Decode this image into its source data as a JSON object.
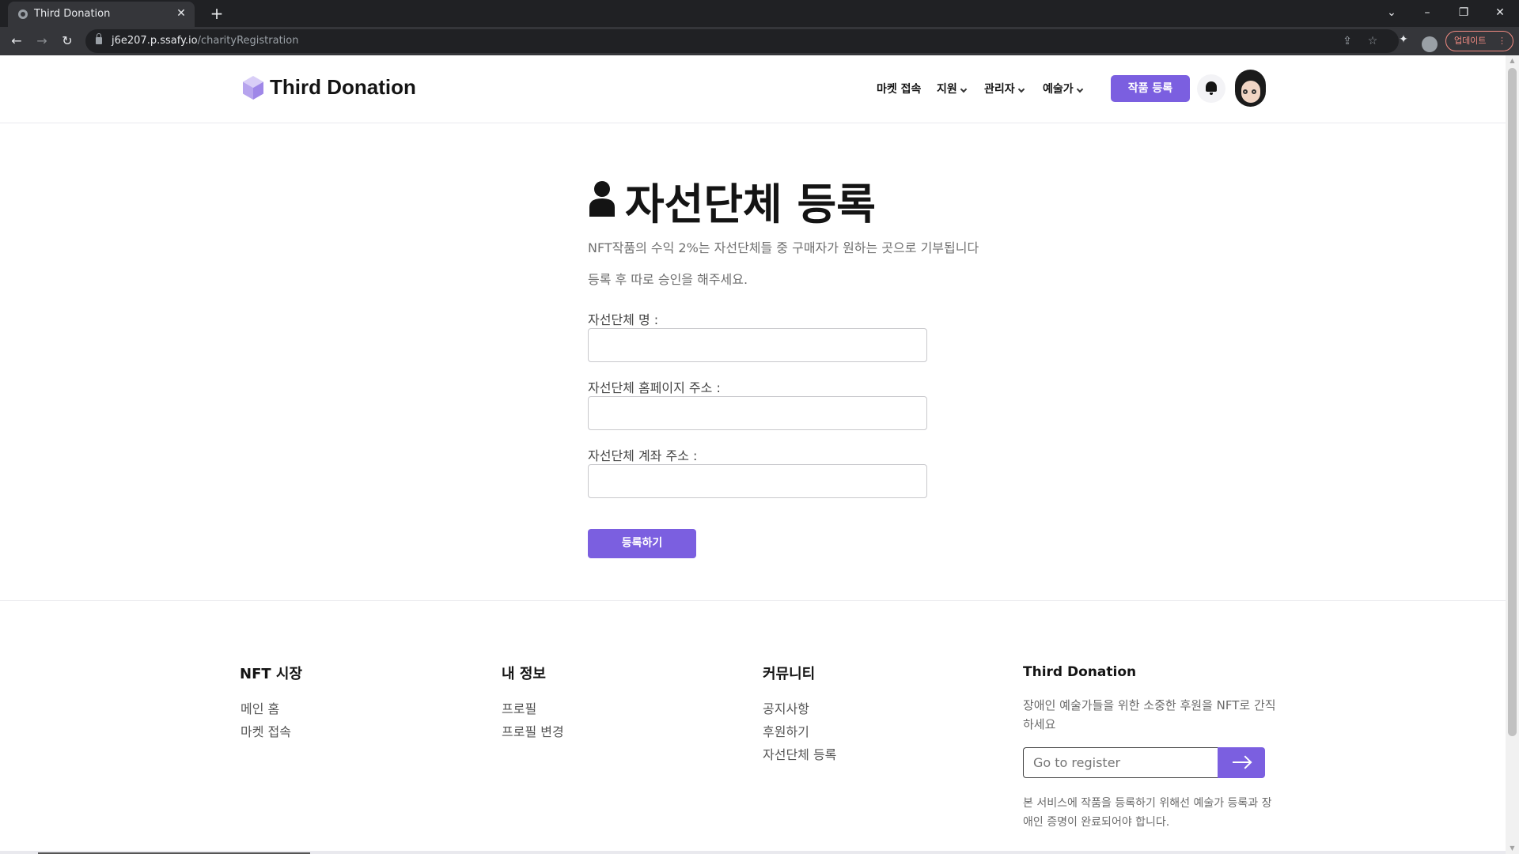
{
  "browser": {
    "tab_title": "Third Donation",
    "tab_close": "✕",
    "new_tab": "+",
    "url_host": "j6e207.p.ssafy.io",
    "url_path": "/charityRegistration",
    "update_label": "업데이트",
    "update_menu": "⋮",
    "window": {
      "tab_search": "⌄",
      "minimize": "–",
      "restore": "❐",
      "close": "✕"
    },
    "nav": {
      "back": "←",
      "forward": "→",
      "reload": "↻"
    },
    "icons": {
      "share": "share-icon",
      "bookmark": "☆",
      "extensions": "puzzle-icon"
    }
  },
  "header": {
    "logo": "Third Donation",
    "nav": [
      {
        "label": "마켓 접속",
        "dropdown": false
      },
      {
        "label": "지원",
        "dropdown": true
      },
      {
        "label": "관리자",
        "dropdown": true
      },
      {
        "label": "예술가",
        "dropdown": true
      }
    ],
    "cta": "작품 등록",
    "brand_color": "#7b5fe0"
  },
  "main": {
    "title": "자선단체 등록",
    "desc1": "NFT작품의 수익 2%는 자선단체들 중 구매자가 원하는 곳으로 기부됩니다",
    "desc2": "등록 후 따로 승인을 해주세요.",
    "fields": [
      {
        "label": "자선단체 명 :",
        "value": ""
      },
      {
        "label": "자선단체 홈페이지 주소 :",
        "value": ""
      },
      {
        "label": "자선단체 계좌 주소 :",
        "value": ""
      }
    ],
    "submit": "등록하기"
  },
  "footer": {
    "col1": {
      "heading": "NFT 시장",
      "links": [
        "메인 홈",
        "마켓 접속"
      ]
    },
    "col2": {
      "heading": "내 정보",
      "links": [
        "프로필",
        "프로필 변경"
      ]
    },
    "col3": {
      "heading": "커뮤니티",
      "links": [
        "공지사항",
        "후원하기",
        "자선단체 등록"
      ]
    },
    "col4": {
      "heading": "Third Donation",
      "text": "장애인 예술가들을 위한 소중한 후원을 NFT로 간직하세요",
      "input_placeholder": "Go to register",
      "note": "본 서비스에 작품을 등록하기 위해선 예술가 등록과 장애인 증명이 완료되어야 합니다."
    }
  }
}
